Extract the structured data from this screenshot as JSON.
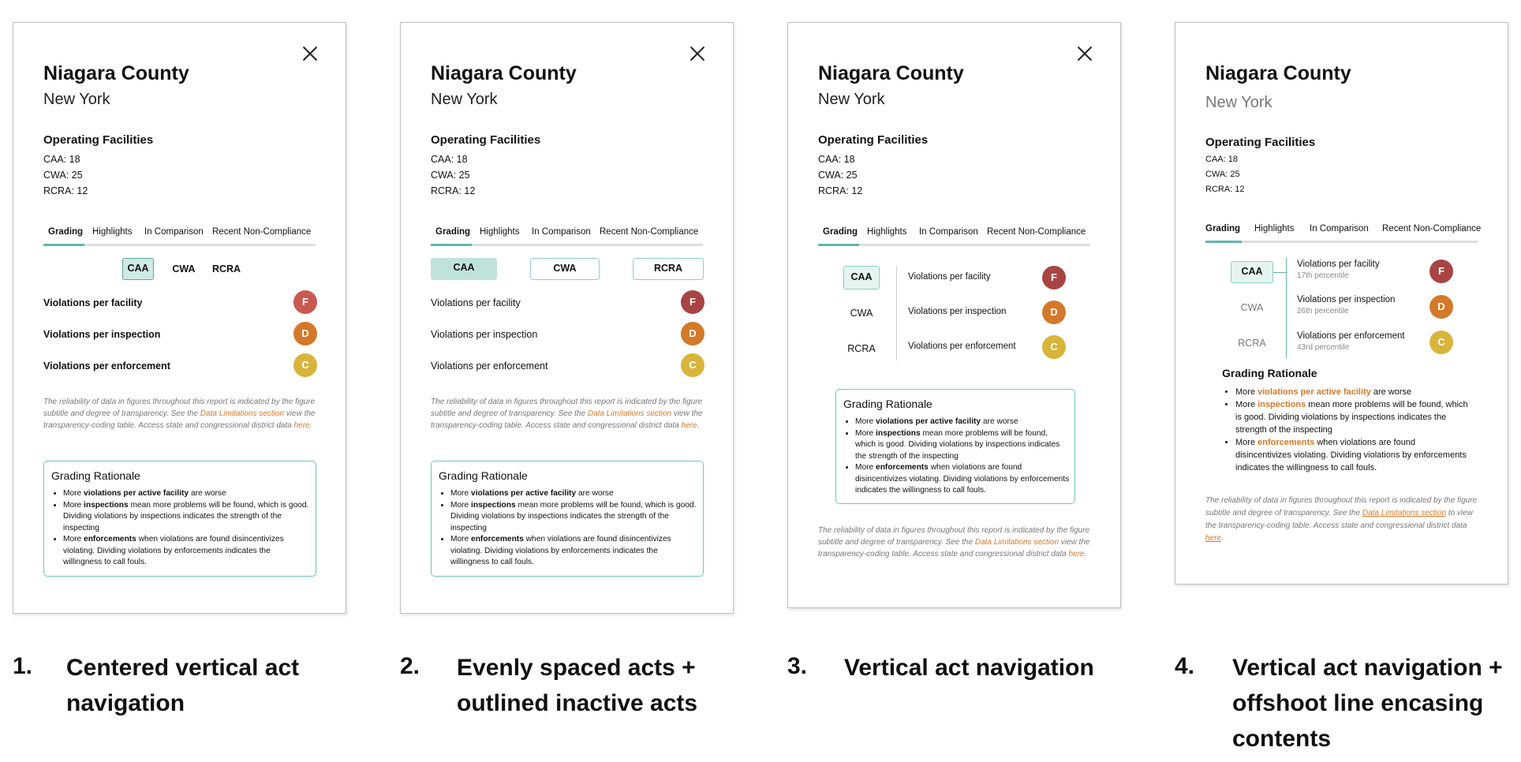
{
  "colors": {
    "accent": "#5fb7a8",
    "link": "#d4782a",
    "grade_f": "#b84848",
    "grade_d": "#d4782a",
    "grade_c": "#d8b43a"
  },
  "panel": {
    "county": "Niagara County",
    "state": "New York",
    "facilities_title": "Operating Facilities",
    "facilities": [
      "CAA: 18",
      "CWA: 25",
      "RCRA: 12"
    ],
    "tabs": [
      "Grading",
      "Highlights",
      "In Comparison",
      "Recent Non-Compliance"
    ],
    "acts": [
      "CAA",
      "CWA",
      "RCRA"
    ],
    "metrics": [
      "Violations per facility",
      "Violations per inspection",
      "Violations per enforcement"
    ],
    "percentiles": [
      "17th percentile",
      "26th percentile",
      "43rd percentile"
    ],
    "grades": [
      "F",
      "D",
      "C"
    ],
    "disclaimer": {
      "part1": "The reliability of data in figures throughout this report is indicated by the figure subtitle and degree of transparency. See the ",
      "link1": "Data Limitations section",
      "part2": " view the transparency-coding table. Access state and congressional district data ",
      "link2": "here",
      "part3": ".",
      "part2_v4": " to view the transparency-coding table. Access state and congressional district data "
    },
    "rationale": {
      "title": "Grading Rationale",
      "item1_pre": "More ",
      "item1_bold": "violations per active facility",
      "item1_post": " are worse",
      "item2_pre": "More ",
      "item2_bold": "inspections",
      "item2_post": " mean more problems will be found, which is good. Dividing violations by inspections indicates the strength of the inspecting",
      "item3_pre": "More ",
      "item3_bold": "enforcements",
      "item3_post": " when violations are found disincentivizes violating. Dividing violations by enforcements indicates the willingness to call fouls."
    }
  },
  "captions": [
    {
      "num": "1.",
      "text": [
        "Centered vertical act",
        "navigation"
      ]
    },
    {
      "num": "2.",
      "text": [
        "Evenly spaced acts +",
        "outlined inactive acts"
      ]
    },
    {
      "num": "3.",
      "text": [
        "Vertical act navigation"
      ]
    },
    {
      "num": "4.",
      "text": [
        "Vertical act navigation +",
        "offshoot line encasing",
        "contents"
      ]
    }
  ]
}
